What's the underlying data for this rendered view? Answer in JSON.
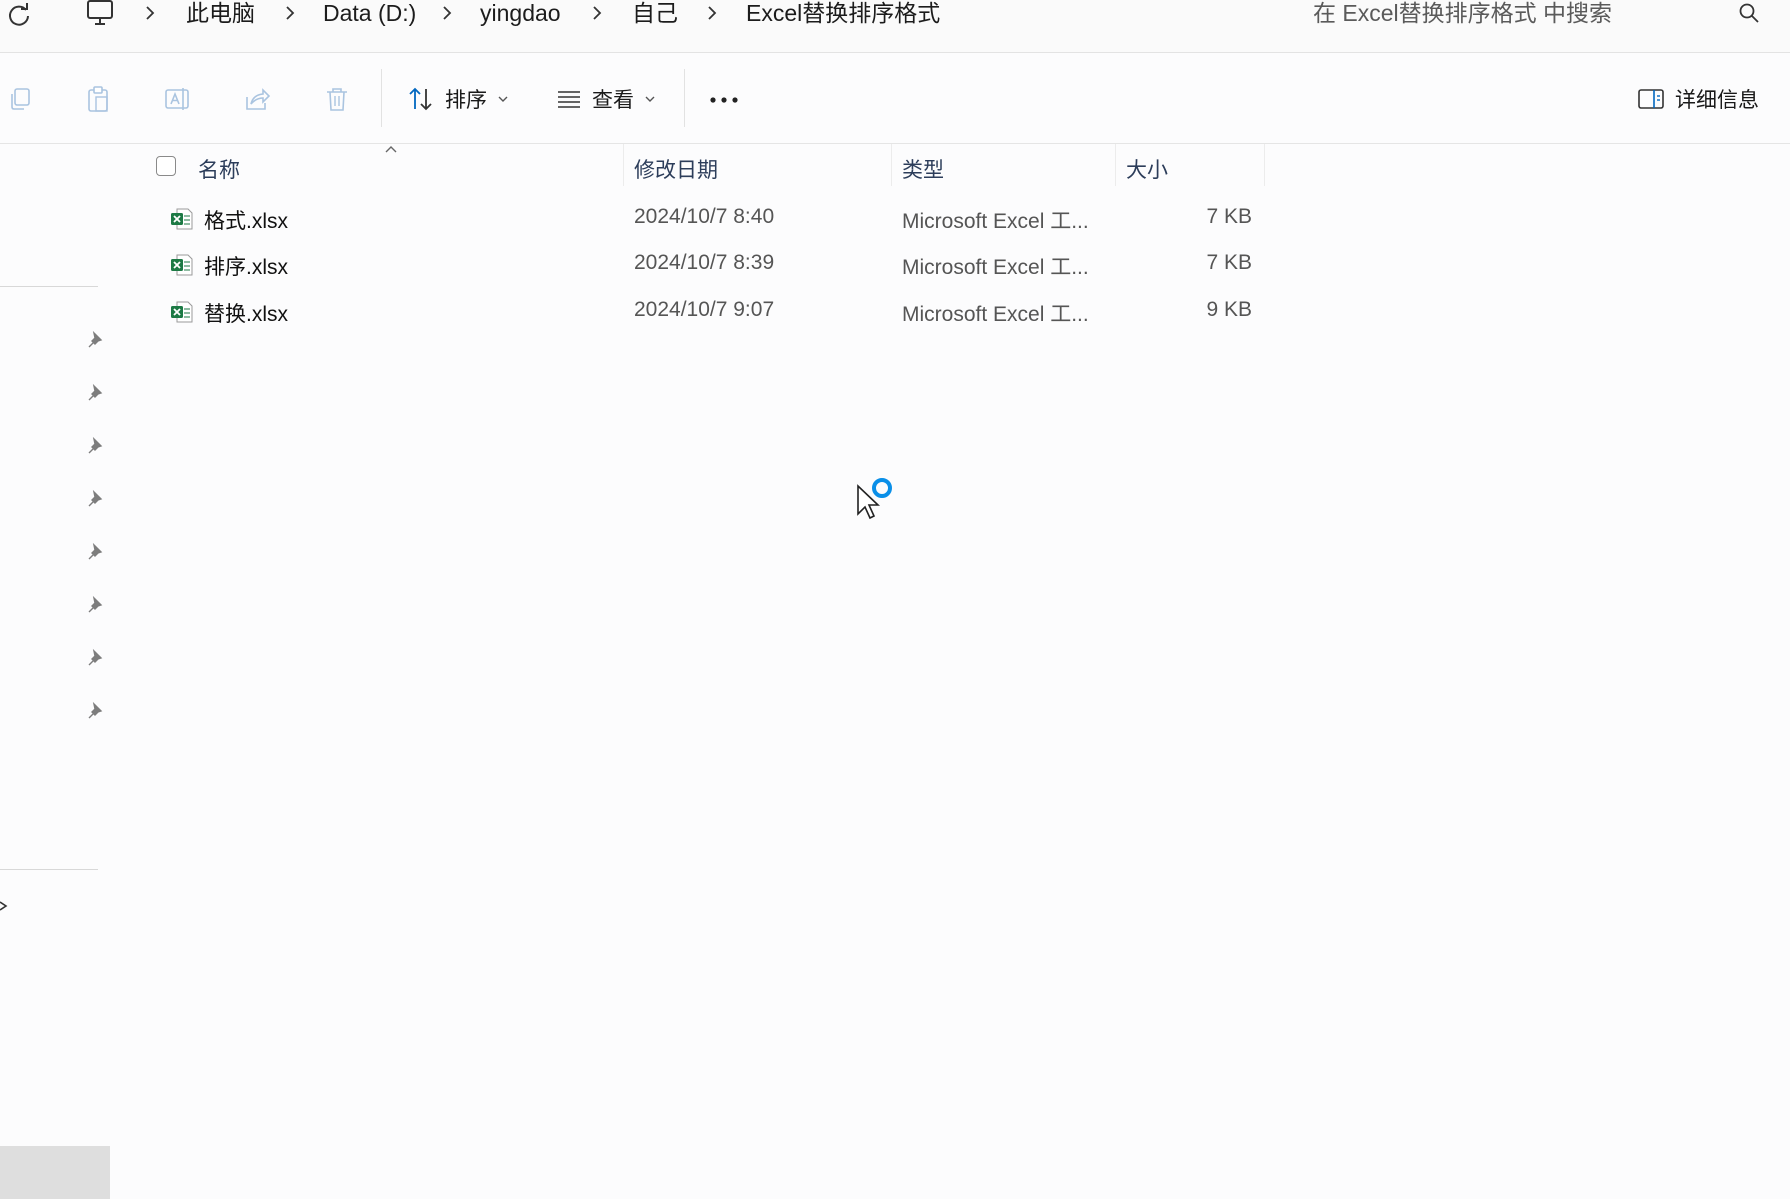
{
  "address_bar": {
    "breadcrumbs": [
      "此电脑",
      "Data (D:)",
      "yingdao",
      "自己",
      "Excel替换排序格式"
    ],
    "search_placeholder": "在 Excel替换排序格式 中搜索"
  },
  "toolbar": {
    "sort_label": "排序",
    "view_label": "查看",
    "details_label": "详细信息"
  },
  "columns": {
    "name": "名称",
    "date": "修改日期",
    "type": "类型",
    "size": "大小"
  },
  "files": [
    {
      "name": "格式.xlsx",
      "date": "2024/10/7 8:40",
      "type": "Microsoft Excel 工...",
      "size": "7 KB"
    },
    {
      "name": "排序.xlsx",
      "date": "2024/10/7 8:39",
      "type": "Microsoft Excel 工...",
      "size": "7 KB"
    },
    {
      "name": "替换.xlsx",
      "date": "2024/10/7 9:07",
      "type": "Microsoft Excel 工...",
      "size": "9 KB"
    }
  ],
  "icons": {
    "file_type": "excel-file-icon",
    "pinned": "pin-icon",
    "cursor": "busy-cursor-icon"
  },
  "colors": {
    "accent": "#0067c0",
    "excel_green": "#1d7a45",
    "header_text": "#2c3d5a"
  }
}
